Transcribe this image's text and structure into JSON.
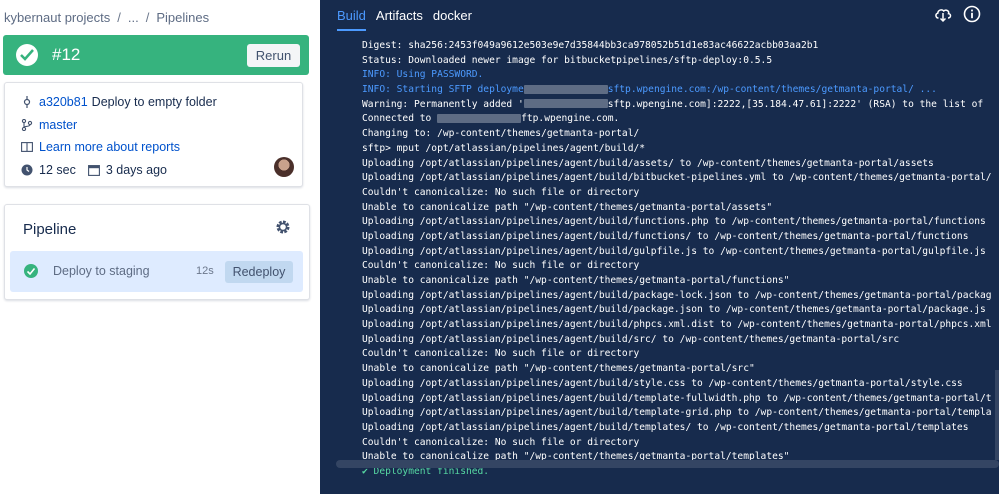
{
  "breadcrumb": [
    "kybernaut projects",
    "...",
    "Pipelines"
  ],
  "build": {
    "number": "#12",
    "rerun_label": "Rerun",
    "status_color": "#36b37e"
  },
  "info": {
    "commit_hash": "a320b81",
    "commit_message": "Deploy to empty folder",
    "branch": "master",
    "reports_link": "Learn more about reports",
    "duration": "12 sec",
    "date": "3 days ago"
  },
  "pipeline": {
    "title": "Pipeline",
    "step_name": "Deploy to staging",
    "step_time": "12s",
    "redeploy_label": "Redeploy"
  },
  "tabs": [
    "Build",
    "Artifacts",
    "docker"
  ],
  "log": [
    {
      "type": "normal",
      "text": "Digest: sha256:2453f049a9612e503e9e7d35844bb3ca978052b51d1e83ac46622acbb03aa2b1"
    },
    {
      "type": "normal",
      "text": "Status: Downloaded newer image for bitbucketpipelines/sftp-deploy:0.5.5"
    },
    {
      "type": "info",
      "text": "INFO: Using PASSWORD."
    },
    {
      "type": "info",
      "pre": "INFO: Starting SFTP deployme",
      "redact": true,
      "post": "sftp.wpengine.com:/wp-content/themes/getmanta-portal/ ..."
    },
    {
      "type": "normal",
      "pre": "Warning: Permanently added '",
      "redact": true,
      "post": "sftp.wpengine.com]:2222,[35.184.47.61]:2222' (RSA) to the list of"
    },
    {
      "type": "normal",
      "pre": "Connected to ",
      "redact": true,
      "post": "ftp.wpengine.com."
    },
    {
      "type": "normal",
      "text": "Changing to: /wp-content/themes/getmanta-portal/"
    },
    {
      "type": "normal",
      "text": "sftp> mput /opt/atlassian/pipelines/agent/build/*"
    },
    {
      "type": "normal",
      "text": "Uploading /opt/atlassian/pipelines/agent/build/assets/ to /wp-content/themes/getmanta-portal/assets"
    },
    {
      "type": "normal",
      "text": "Uploading /opt/atlassian/pipelines/agent/build/bitbucket-pipelines.yml to /wp-content/themes/getmanta-portal/"
    },
    {
      "type": "normal",
      "text": "Couldn't canonicalize: No such file or directory"
    },
    {
      "type": "normal",
      "text": "Unable to canonicalize path \"/wp-content/themes/getmanta-portal/assets\""
    },
    {
      "type": "normal",
      "text": "Uploading /opt/atlassian/pipelines/agent/build/functions.php to /wp-content/themes/getmanta-portal/functions"
    },
    {
      "type": "normal",
      "text": "Uploading /opt/atlassian/pipelines/agent/build/functions/ to /wp-content/themes/getmanta-portal/functions"
    },
    {
      "type": "normal",
      "text": "Uploading /opt/atlassian/pipelines/agent/build/gulpfile.js to /wp-content/themes/getmanta-portal/gulpfile.js"
    },
    {
      "type": "normal",
      "text": "Couldn't canonicalize: No such file or directory"
    },
    {
      "type": "normal",
      "text": "Unable to canonicalize path \"/wp-content/themes/getmanta-portal/functions\""
    },
    {
      "type": "normal",
      "text": "Uploading /opt/atlassian/pipelines/agent/build/package-lock.json to /wp-content/themes/getmanta-portal/packag"
    },
    {
      "type": "normal",
      "text": "Uploading /opt/atlassian/pipelines/agent/build/package.json to /wp-content/themes/getmanta-portal/package.js"
    },
    {
      "type": "normal",
      "text": "Uploading /opt/atlassian/pipelines/agent/build/phpcs.xml.dist to /wp-content/themes/getmanta-portal/phpcs.xml"
    },
    {
      "type": "normal",
      "text": "Uploading /opt/atlassian/pipelines/agent/build/src/ to /wp-content/themes/getmanta-portal/src"
    },
    {
      "type": "normal",
      "text": "Couldn't canonicalize: No such file or directory"
    },
    {
      "type": "normal",
      "text": "Unable to canonicalize path \"/wp-content/themes/getmanta-portal/src\""
    },
    {
      "type": "normal",
      "text": "Uploading /opt/atlassian/pipelines/agent/build/style.css to /wp-content/themes/getmanta-portal/style.css"
    },
    {
      "type": "normal",
      "text": "Uploading /opt/atlassian/pipelines/agent/build/template-fullwidth.php to /wp-content/themes/getmanta-portal/t"
    },
    {
      "type": "normal",
      "text": "Uploading /opt/atlassian/pipelines/agent/build/template-grid.php to /wp-content/themes/getmanta-portal/templa"
    },
    {
      "type": "normal",
      "text": "Uploading /opt/atlassian/pipelines/agent/build/templates/ to /wp-content/themes/getmanta-portal/templates"
    },
    {
      "type": "normal",
      "text": "Couldn't canonicalize: No such file or directory"
    },
    {
      "type": "normal",
      "text": "Unable to canonicalize path \"/wp-content/themes/getmanta-portal/templates\""
    },
    {
      "type": "success",
      "text": "✔ Deployment finished."
    }
  ],
  "colors": {
    "success": "#36b37e",
    "link": "#0052cc",
    "log_bg": "#172b4d",
    "info_text": "#4c9aff",
    "success_text": "#57d9a3"
  },
  "icons": {
    "cloud_download": "cloud-download-icon",
    "info": "info-icon",
    "gear": "gear-icon"
  }
}
